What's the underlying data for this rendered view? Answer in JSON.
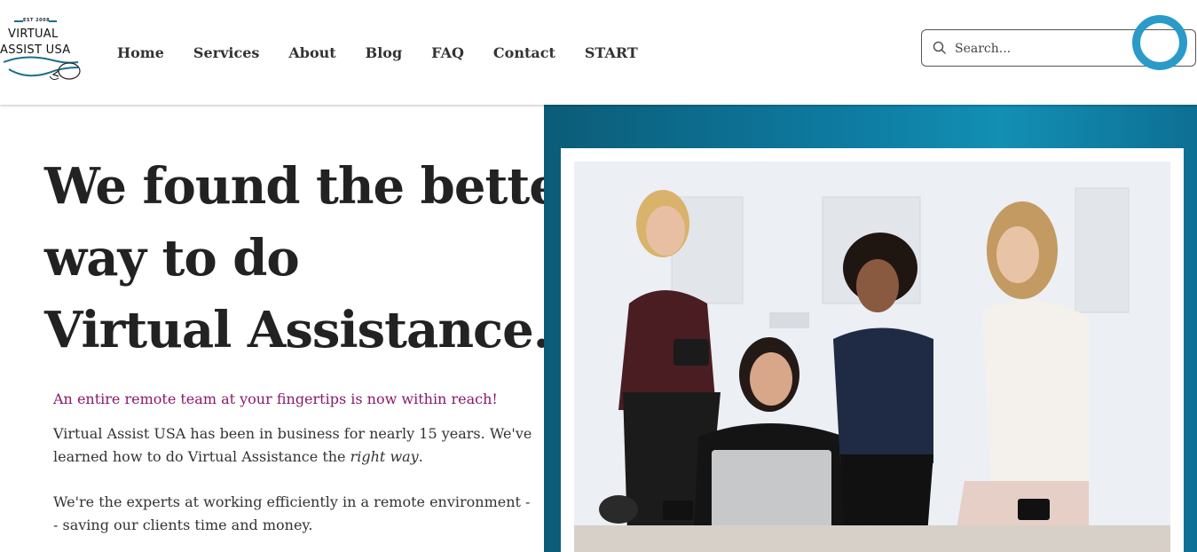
{
  "logo": {
    "est": "EST 2008",
    "line1": "VIRTUAL",
    "line2": "ASSIST USA"
  },
  "nav": {
    "items": [
      "Home",
      "Services",
      "About",
      "Blog",
      "FAQ",
      "Contact",
      "START"
    ]
  },
  "search": {
    "placeholder": "Search..."
  },
  "hero": {
    "headline": [
      "We found the better",
      "way to do",
      "Virtual Assistance."
    ],
    "tagline": "An entire remote team at your fingertips is now within reach!",
    "para1_pre": "Virtual Assist USA has been in business for nearly 15 years. We've learned how to do Virtual Assistance the ",
    "para1_em": "right way",
    "para1_post": ".",
    "para2": "We're the experts at working efficiently in a remote environment -- saving our clients time and money."
  },
  "colors": {
    "accent_teal": "#0e7aa0",
    "tagline_magenta": "#8a1a66",
    "ring_blue": "#2a9ac9"
  },
  "icons": {
    "search": "search-icon",
    "logo": "lightbulb-icon"
  }
}
